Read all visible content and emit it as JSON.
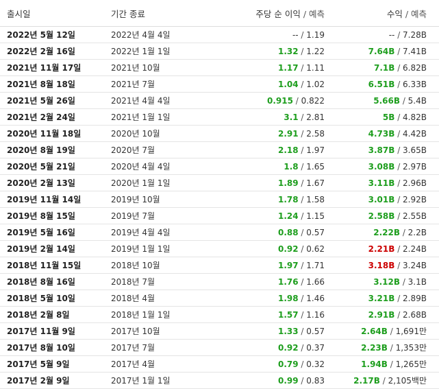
{
  "table": {
    "headers": {
      "release_date": "출시일",
      "period_end": "기간 종료",
      "eps": "주당 순 이익",
      "eps_forecast": "/ 예측",
      "revenue": "수익",
      "revenue_forecast": "/ 예측"
    },
    "rows": [
      {
        "date": "2022년 5월 12일",
        "period": "2022년 4월 4일",
        "eps": "--",
        "eps_status": "none",
        "eps_forecast": "1.19",
        "revenue": "--",
        "revenue_status": "none",
        "revenue_forecast": "7.28B"
      },
      {
        "date": "2022년 2월 16일",
        "period": "2022년 1월 1일",
        "eps": "1.32",
        "eps_status": "beat",
        "eps_forecast": "1.22",
        "revenue": "7.64B",
        "revenue_status": "beat",
        "revenue_forecast": "7.41B"
      },
      {
        "date": "2021년 11월 17일",
        "period": "2021년 10월",
        "eps": "1.17",
        "eps_status": "beat",
        "eps_forecast": "1.11",
        "revenue": "7.1B",
        "revenue_status": "beat",
        "revenue_forecast": "6.82B"
      },
      {
        "date": "2021년 8월 18일",
        "period": "2021년 7월",
        "eps": "1.04",
        "eps_status": "beat",
        "eps_forecast": "1.02",
        "revenue": "6.51B",
        "revenue_status": "beat",
        "revenue_forecast": "6.33B"
      },
      {
        "date": "2021년 5월 26일",
        "period": "2021년 4월 4일",
        "eps": "0.915",
        "eps_status": "beat",
        "eps_forecast": "0.822",
        "revenue": "5.66B",
        "revenue_status": "beat",
        "revenue_forecast": "5.4B"
      },
      {
        "date": "2021년 2월 24일",
        "period": "2021년 1월 1일",
        "eps": "3.1",
        "eps_status": "beat",
        "eps_forecast": "2.81",
        "revenue": "5B",
        "revenue_status": "beat",
        "revenue_forecast": "4.82B"
      },
      {
        "date": "2020년 11월 18일",
        "period": "2020년 10월",
        "eps": "2.91",
        "eps_status": "beat",
        "eps_forecast": "2.58",
        "revenue": "4.73B",
        "revenue_status": "beat",
        "revenue_forecast": "4.42B"
      },
      {
        "date": "2020년 8월 19일",
        "period": "2020년 7월",
        "eps": "2.18",
        "eps_status": "beat",
        "eps_forecast": "1.97",
        "revenue": "3.87B",
        "revenue_status": "beat",
        "revenue_forecast": "3.65B"
      },
      {
        "date": "2020년 5월 21일",
        "period": "2020년 4월 4일",
        "eps": "1.8",
        "eps_status": "beat",
        "eps_forecast": "1.65",
        "revenue": "3.08B",
        "revenue_status": "beat",
        "revenue_forecast": "2.97B"
      },
      {
        "date": "2020년 2월 13일",
        "period": "2020년 1월 1일",
        "eps": "1.89",
        "eps_status": "beat",
        "eps_forecast": "1.67",
        "revenue": "3.11B",
        "revenue_status": "beat",
        "revenue_forecast": "2.96B"
      },
      {
        "date": "2019년 11월 14일",
        "period": "2019년 10월",
        "eps": "1.78",
        "eps_status": "beat",
        "eps_forecast": "1.58",
        "revenue": "3.01B",
        "revenue_status": "beat",
        "revenue_forecast": "2.92B"
      },
      {
        "date": "2019년 8월 15일",
        "period": "2019년 7월",
        "eps": "1.24",
        "eps_status": "beat",
        "eps_forecast": "1.15",
        "revenue": "2.58B",
        "revenue_status": "beat",
        "revenue_forecast": "2.55B"
      },
      {
        "date": "2019년 5월 16일",
        "period": "2019년 4월 4일",
        "eps": "0.88",
        "eps_status": "beat",
        "eps_forecast": "0.57",
        "revenue": "2.22B",
        "revenue_status": "beat",
        "revenue_forecast": "2.2B"
      },
      {
        "date": "2019년 2월 14일",
        "period": "2019년 1월 1일",
        "eps": "0.92",
        "eps_status": "beat",
        "eps_forecast": "0.62",
        "revenue": "2.21B",
        "revenue_status": "miss",
        "revenue_forecast": "2.24B"
      },
      {
        "date": "2018년 11월 15일",
        "period": "2018년 10월",
        "eps": "1.97",
        "eps_status": "beat",
        "eps_forecast": "1.71",
        "revenue": "3.18B",
        "revenue_status": "miss",
        "revenue_forecast": "3.24B"
      },
      {
        "date": "2018년 8월 16일",
        "period": "2018년 7월",
        "eps": "1.76",
        "eps_status": "beat",
        "eps_forecast": "1.66",
        "revenue": "3.12B",
        "revenue_status": "beat",
        "revenue_forecast": "3.1B"
      },
      {
        "date": "2018년 5월 10일",
        "period": "2018년 4월",
        "eps": "1.98",
        "eps_status": "beat",
        "eps_forecast": "1.46",
        "revenue": "3.21B",
        "revenue_status": "beat",
        "revenue_forecast": "2.89B"
      },
      {
        "date": "2018년 2월 8일",
        "period": "2018년 1월 1일",
        "eps": "1.57",
        "eps_status": "beat",
        "eps_forecast": "1.16",
        "revenue": "2.91B",
        "revenue_status": "beat",
        "revenue_forecast": "2.68B"
      },
      {
        "date": "2017년 11월 9일",
        "period": "2017년 10월",
        "eps": "1.33",
        "eps_status": "beat",
        "eps_forecast": "0.57",
        "revenue": "2.64B",
        "revenue_status": "beat",
        "revenue_forecast": "1,691만"
      },
      {
        "date": "2017년 8월 10일",
        "period": "2017년 7월",
        "eps": "0.92",
        "eps_status": "beat",
        "eps_forecast": "0.37",
        "revenue": "2.23B",
        "revenue_status": "beat",
        "revenue_forecast": "1,353만"
      },
      {
        "date": "2017년 5월 9일",
        "period": "2017년 4월",
        "eps": "0.79",
        "eps_status": "beat",
        "eps_forecast": "0.32",
        "revenue": "1.94B",
        "revenue_status": "beat",
        "revenue_forecast": "1,265만"
      },
      {
        "date": "2017년 2월 9일",
        "period": "2017년 1월 1일",
        "eps": "0.99",
        "eps_status": "beat",
        "eps_forecast": "0.83",
        "revenue": "2.17B",
        "revenue_status": "beat",
        "revenue_forecast": "2,105백만"
      }
    ]
  },
  "colors": {
    "beat": "#1e9e1e",
    "miss": "#cc0000",
    "text": "#333333"
  }
}
